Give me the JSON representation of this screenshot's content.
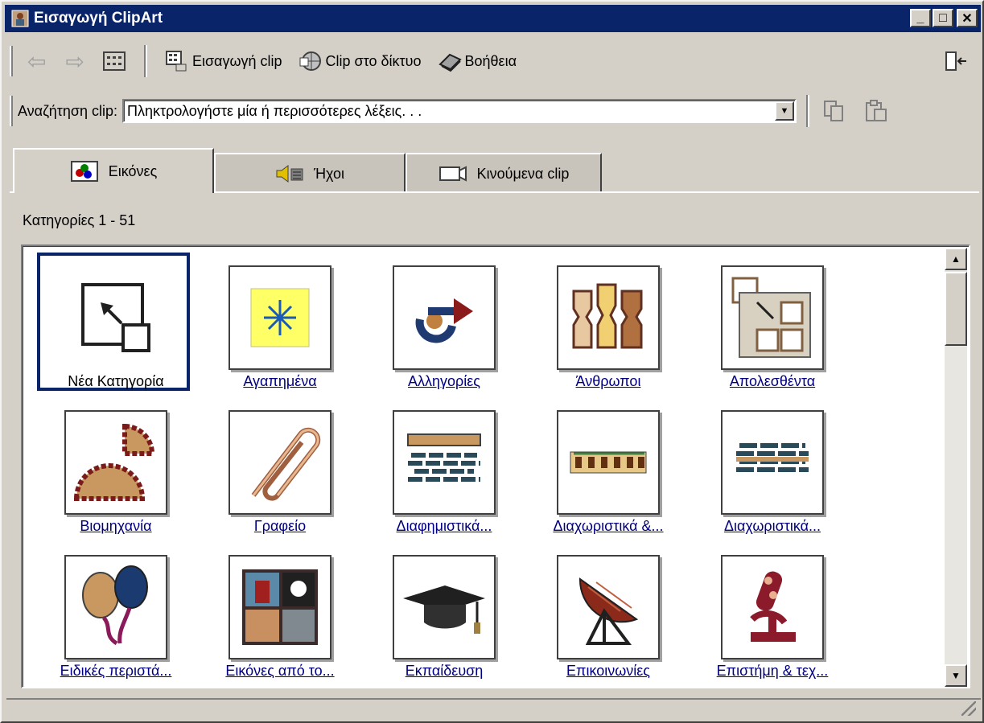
{
  "window": {
    "title": "Εισαγωγή ClipArt",
    "minimize": "_",
    "maximize": "□",
    "close": "✕"
  },
  "toolbar": {
    "back_glyph": "⇦",
    "forward_glyph": "⇨",
    "insert_clip_label": "Εισαγωγή clip",
    "clips_online_label": "Clip στο δίκτυο",
    "help_label": "Βοήθεια"
  },
  "search": {
    "label": "Αναζήτηση clip:",
    "value": "Πληκτρολογήστε μία ή περισσότερες λέξεις. . ."
  },
  "tabs": [
    {
      "label": "Εικόνες"
    },
    {
      "label": "Ήχοι"
    },
    {
      "label": "Κινούμενα clip"
    }
  ],
  "category_count": "Κατηγορίες 1 - 51",
  "categories": [
    {
      "label": "Νέα Κατηγορία",
      "icon": "new-category-icon"
    },
    {
      "label": "Αγαπημένα",
      "icon": "favorites-icon"
    },
    {
      "label": "Αλληγορίες",
      "icon": "allegories-icon"
    },
    {
      "label": "Άνθρωποι",
      "icon": "people-icon"
    },
    {
      "label": "Απολεσθέντα",
      "icon": "lost-found-icon"
    },
    {
      "label": "Βιομηχανία",
      "icon": "industry-icon"
    },
    {
      "label": "Γραφείο",
      "icon": "office-paperclip-icon"
    },
    {
      "label": "Διαφημιστικά...",
      "icon": "banners-icon"
    },
    {
      "label": "Διαχωριστικά &...",
      "icon": "dividers-icon"
    },
    {
      "label": "Διαχωριστικά...",
      "icon": "dividers-2-icon"
    },
    {
      "label": "Ειδικές περιστά...",
      "icon": "balloons-icon"
    },
    {
      "label": "Εικόνες από το...",
      "icon": "photos-icon"
    },
    {
      "label": "Εκπαίδευση",
      "icon": "graduation-cap-icon"
    },
    {
      "label": "Επικοινωνίες",
      "icon": "satellite-dish-icon"
    },
    {
      "label": "Επιστήμη & τεχ...",
      "icon": "microscope-icon"
    }
  ],
  "colors": {
    "title_bar": "#0a246a",
    "link": "#000080",
    "face": "#d4d0c8"
  }
}
